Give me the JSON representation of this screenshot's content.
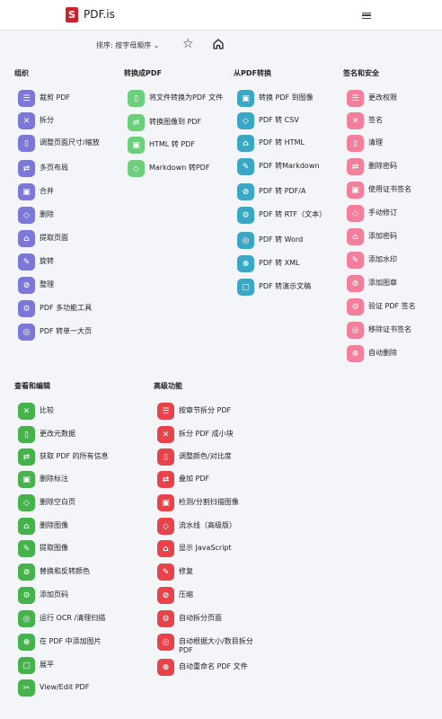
{
  "header": {
    "brand": "PDF.is",
    "logo_letter": "S"
  },
  "toolbar": {
    "sort_label": "排序: 按字母顺序 ⌄"
  },
  "colors": {
    "organize": "#7d78d8",
    "convert_to": "#6ccf7b",
    "convert_from": "#3aa7c4",
    "security": "#f27f9b",
    "view_edit": "#45b24b",
    "advanced": "#e8434a"
  },
  "sections": {
    "organize": {
      "title": "组织",
      "items": [
        "裁剪 PDF",
        "拆分",
        "调整页面尺寸/缩放",
        "多页布局",
        "合并",
        "删除",
        "提取页面",
        "旋转",
        "整理",
        "PDF 多功能工具",
        "PDF 转单一大页"
      ]
    },
    "convert_to": {
      "title": "转换成PDF",
      "items": [
        "将文件转换为PDF 文件",
        "转换图像到 PDF",
        "HTML 转 PDF",
        "Markdown 转PDF"
      ]
    },
    "convert_from": {
      "title": "从PDF转换",
      "items": [
        "转换 PDF 到图像",
        "PDF 转 CSV",
        "PDF 转 HTML",
        "PDF 转Markdown",
        "PDF 转 PDF/A",
        "PDF 转 RTF（文本）",
        "PDF 转 Word",
        "PDF 转 XML",
        "PDF 转演示文稿"
      ]
    },
    "security": {
      "title": "签名和安全",
      "items": [
        "更改权限",
        "签名",
        "清理",
        "删除密码",
        "使用证书签名",
        "手动修订",
        "添加密码",
        "添加水印",
        "添加图章",
        "验证 PDF 签名",
        "移除证书签名",
        "自动删除"
      ]
    },
    "view_edit": {
      "title": "查看和编辑",
      "items": [
        "比较",
        "更改元数据",
        "获取 PDF 的所有信息",
        "删除标注",
        "删除空白页",
        "删除图像",
        "提取图像",
        "替换和反转颜色",
        "添加页码",
        "运行 OCR /清理扫描",
        "在 PDF 中添加图片",
        "展平",
        "View/Edit PDF"
      ]
    },
    "advanced": {
      "title": "高级功能",
      "items": [
        "按章节拆分 PDF",
        "拆分 PDF 成小块",
        "调整颜色/对比度",
        "叠加 PDF",
        "检测/分割扫描图像",
        "流水线（高级版）",
        "显示 JavaScript",
        "修复",
        "压缩",
        "自动拆分页面",
        "自动根据大小/数目拆分PDF",
        "自动重命名 PDF 文件"
      ]
    }
  },
  "icons": {
    "organize": [
      "crop-icon",
      "scissors-icon",
      "resize-icon",
      "grid-icon",
      "merge-icon",
      "delete-icon",
      "extract-icon",
      "rotate-icon",
      "list-icon",
      "tools-icon",
      "single-page-icon"
    ],
    "convert_to": [
      "file-convert-icon",
      "image-pdf-icon",
      "html-icon",
      "markdown-icon"
    ],
    "convert_from": [
      "image-icon",
      "csv-icon",
      "html-icon",
      "markdown-icon",
      "pdfa-icon",
      "text-icon",
      "word-icon",
      "xml-icon",
      "slides-icon"
    ],
    "security": [
      "shield-icon",
      "signature-icon",
      "clean-icon",
      "unlock-icon",
      "certificate-icon",
      "redact-icon",
      "lock-icon",
      "watermark-icon",
      "stamp-icon",
      "verify-icon",
      "remove-cert-icon",
      "auto-delete-icon"
    ],
    "view_edit": [
      "compare-icon",
      "metadata-icon",
      "info-icon",
      "remove-annotation-icon",
      "blank-page-icon",
      "remove-image-icon",
      "extract-image-icon",
      "color-icon",
      "page-number-icon",
      "ocr-icon",
      "add-image-icon",
      "flatten-icon",
      "edit-icon"
    ],
    "advanced": [
      "split-chapter-icon",
      "split-chunk-icon",
      "palette-icon",
      "overlay-icon",
      "scan-split-icon",
      "pipeline-icon",
      "javascript-icon",
      "repair-icon",
      "compress-icon",
      "auto-split-icon",
      "split-size-icon",
      "auto-rename-icon"
    ]
  }
}
